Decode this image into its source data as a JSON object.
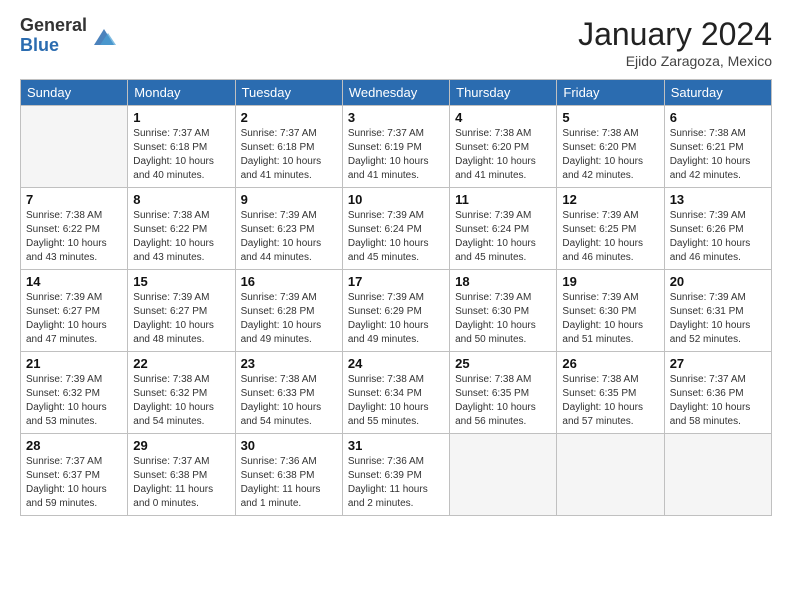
{
  "logo": {
    "general": "General",
    "blue": "Blue"
  },
  "header": {
    "month": "January 2024",
    "location": "Ejido Zaragoza, Mexico"
  },
  "weekdays": [
    "Sunday",
    "Monday",
    "Tuesday",
    "Wednesday",
    "Thursday",
    "Friday",
    "Saturday"
  ],
  "weeks": [
    [
      {
        "day": "",
        "empty": true
      },
      {
        "day": "1",
        "sunrise": "Sunrise: 7:37 AM",
        "sunset": "Sunset: 6:18 PM",
        "daylight": "Daylight: 10 hours and 40 minutes."
      },
      {
        "day": "2",
        "sunrise": "Sunrise: 7:37 AM",
        "sunset": "Sunset: 6:18 PM",
        "daylight": "Daylight: 10 hours and 41 minutes."
      },
      {
        "day": "3",
        "sunrise": "Sunrise: 7:37 AM",
        "sunset": "Sunset: 6:19 PM",
        "daylight": "Daylight: 10 hours and 41 minutes."
      },
      {
        "day": "4",
        "sunrise": "Sunrise: 7:38 AM",
        "sunset": "Sunset: 6:20 PM",
        "daylight": "Daylight: 10 hours and 41 minutes."
      },
      {
        "day": "5",
        "sunrise": "Sunrise: 7:38 AM",
        "sunset": "Sunset: 6:20 PM",
        "daylight": "Daylight: 10 hours and 42 minutes."
      },
      {
        "day": "6",
        "sunrise": "Sunrise: 7:38 AM",
        "sunset": "Sunset: 6:21 PM",
        "daylight": "Daylight: 10 hours and 42 minutes."
      }
    ],
    [
      {
        "day": "7",
        "sunrise": "Sunrise: 7:38 AM",
        "sunset": "Sunset: 6:22 PM",
        "daylight": "Daylight: 10 hours and 43 minutes."
      },
      {
        "day": "8",
        "sunrise": "Sunrise: 7:38 AM",
        "sunset": "Sunset: 6:22 PM",
        "daylight": "Daylight: 10 hours and 43 minutes."
      },
      {
        "day": "9",
        "sunrise": "Sunrise: 7:39 AM",
        "sunset": "Sunset: 6:23 PM",
        "daylight": "Daylight: 10 hours and 44 minutes."
      },
      {
        "day": "10",
        "sunrise": "Sunrise: 7:39 AM",
        "sunset": "Sunset: 6:24 PM",
        "daylight": "Daylight: 10 hours and 45 minutes."
      },
      {
        "day": "11",
        "sunrise": "Sunrise: 7:39 AM",
        "sunset": "Sunset: 6:24 PM",
        "daylight": "Daylight: 10 hours and 45 minutes."
      },
      {
        "day": "12",
        "sunrise": "Sunrise: 7:39 AM",
        "sunset": "Sunset: 6:25 PM",
        "daylight": "Daylight: 10 hours and 46 minutes."
      },
      {
        "day": "13",
        "sunrise": "Sunrise: 7:39 AM",
        "sunset": "Sunset: 6:26 PM",
        "daylight": "Daylight: 10 hours and 46 minutes."
      }
    ],
    [
      {
        "day": "14",
        "sunrise": "Sunrise: 7:39 AM",
        "sunset": "Sunset: 6:27 PM",
        "daylight": "Daylight: 10 hours and 47 minutes."
      },
      {
        "day": "15",
        "sunrise": "Sunrise: 7:39 AM",
        "sunset": "Sunset: 6:27 PM",
        "daylight": "Daylight: 10 hours and 48 minutes."
      },
      {
        "day": "16",
        "sunrise": "Sunrise: 7:39 AM",
        "sunset": "Sunset: 6:28 PM",
        "daylight": "Daylight: 10 hours and 49 minutes."
      },
      {
        "day": "17",
        "sunrise": "Sunrise: 7:39 AM",
        "sunset": "Sunset: 6:29 PM",
        "daylight": "Daylight: 10 hours and 49 minutes."
      },
      {
        "day": "18",
        "sunrise": "Sunrise: 7:39 AM",
        "sunset": "Sunset: 6:30 PM",
        "daylight": "Daylight: 10 hours and 50 minutes."
      },
      {
        "day": "19",
        "sunrise": "Sunrise: 7:39 AM",
        "sunset": "Sunset: 6:30 PM",
        "daylight": "Daylight: 10 hours and 51 minutes."
      },
      {
        "day": "20",
        "sunrise": "Sunrise: 7:39 AM",
        "sunset": "Sunset: 6:31 PM",
        "daylight": "Daylight: 10 hours and 52 minutes."
      }
    ],
    [
      {
        "day": "21",
        "sunrise": "Sunrise: 7:39 AM",
        "sunset": "Sunset: 6:32 PM",
        "daylight": "Daylight: 10 hours and 53 minutes."
      },
      {
        "day": "22",
        "sunrise": "Sunrise: 7:38 AM",
        "sunset": "Sunset: 6:32 PM",
        "daylight": "Daylight: 10 hours and 54 minutes."
      },
      {
        "day": "23",
        "sunrise": "Sunrise: 7:38 AM",
        "sunset": "Sunset: 6:33 PM",
        "daylight": "Daylight: 10 hours and 54 minutes."
      },
      {
        "day": "24",
        "sunrise": "Sunrise: 7:38 AM",
        "sunset": "Sunset: 6:34 PM",
        "daylight": "Daylight: 10 hours and 55 minutes."
      },
      {
        "day": "25",
        "sunrise": "Sunrise: 7:38 AM",
        "sunset": "Sunset: 6:35 PM",
        "daylight": "Daylight: 10 hours and 56 minutes."
      },
      {
        "day": "26",
        "sunrise": "Sunrise: 7:38 AM",
        "sunset": "Sunset: 6:35 PM",
        "daylight": "Daylight: 10 hours and 57 minutes."
      },
      {
        "day": "27",
        "sunrise": "Sunrise: 7:37 AM",
        "sunset": "Sunset: 6:36 PM",
        "daylight": "Daylight: 10 hours and 58 minutes."
      }
    ],
    [
      {
        "day": "28",
        "sunrise": "Sunrise: 7:37 AM",
        "sunset": "Sunset: 6:37 PM",
        "daylight": "Daylight: 10 hours and 59 minutes."
      },
      {
        "day": "29",
        "sunrise": "Sunrise: 7:37 AM",
        "sunset": "Sunset: 6:38 PM",
        "daylight": "Daylight: 11 hours and 0 minutes."
      },
      {
        "day": "30",
        "sunrise": "Sunrise: 7:36 AM",
        "sunset": "Sunset: 6:38 PM",
        "daylight": "Daylight: 11 hours and 1 minute."
      },
      {
        "day": "31",
        "sunrise": "Sunrise: 7:36 AM",
        "sunset": "Sunset: 6:39 PM",
        "daylight": "Daylight: 11 hours and 2 minutes."
      },
      {
        "day": "",
        "empty": true
      },
      {
        "day": "",
        "empty": true
      },
      {
        "day": "",
        "empty": true
      }
    ]
  ]
}
